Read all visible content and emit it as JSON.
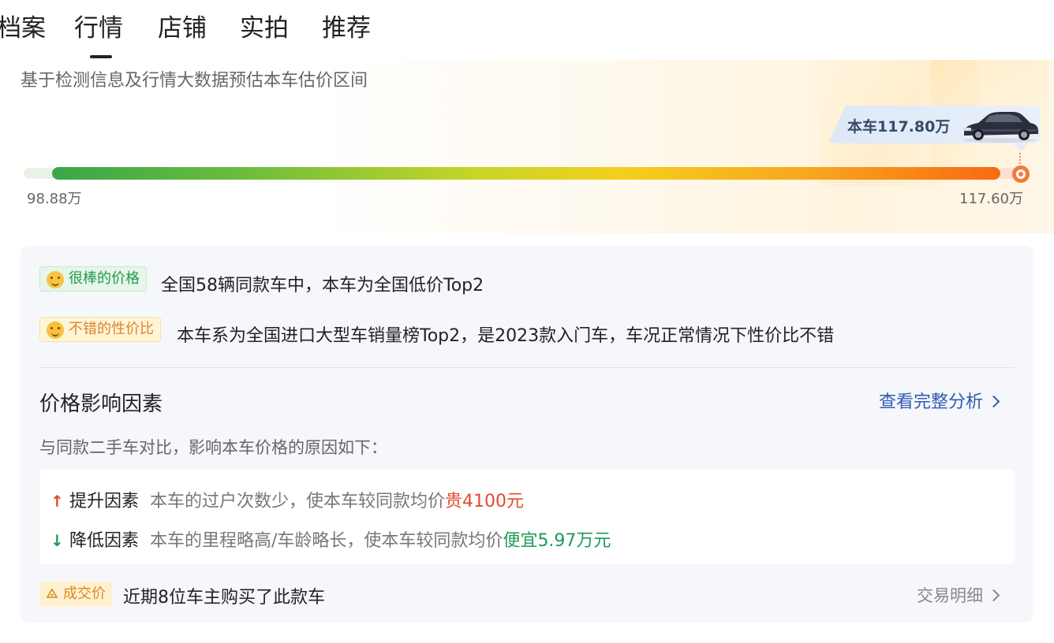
{
  "tabs": [
    {
      "label": "档案"
    },
    {
      "label": "行情"
    },
    {
      "label": "店铺"
    },
    {
      "label": "实拍"
    },
    {
      "label": "推荐"
    }
  ],
  "active_tab": "行情",
  "price_range": {
    "subtitle": "基于检测信息及行情大数据预估本车估价区间",
    "current_price_label": "本车117.80万",
    "min_label": "98.88万",
    "max_label": "117.60万",
    "marker_position_fraction": 0.99
  },
  "highlights": [
    {
      "badge": "很棒的价格",
      "text": "全国58辆同款车中，本车为全国低价Top2",
      "color": "#1f9a4a"
    },
    {
      "badge": "不错的性价比",
      "text": "本车系为全国进口大型车销量榜Top2，是2023款入门车，车况正常情况下性价比不错",
      "color": "#d9882a"
    }
  ],
  "factors_section": {
    "title": "价格影响因素",
    "link_label": "查看完整分析",
    "intro": "与同款二手车对比，影响本车价格的原因如下：",
    "factors": [
      {
        "direction": "up",
        "label": "提升因素",
        "desc": "本车的过户次数少，使本车较同款均价",
        "effect": "贵4100元"
      },
      {
        "direction": "down",
        "label": "降低因素",
        "desc": "本车的里程略高/车龄略长，使本车较同款均价",
        "effect": "便宜5.97万元"
      }
    ]
  },
  "deal": {
    "badge": "成交价",
    "text": "近期8位车主购买了此款车",
    "link_label": "交易明细"
  },
  "icons": {
    "up_arrow": "↑",
    "down_arrow": "↓"
  }
}
